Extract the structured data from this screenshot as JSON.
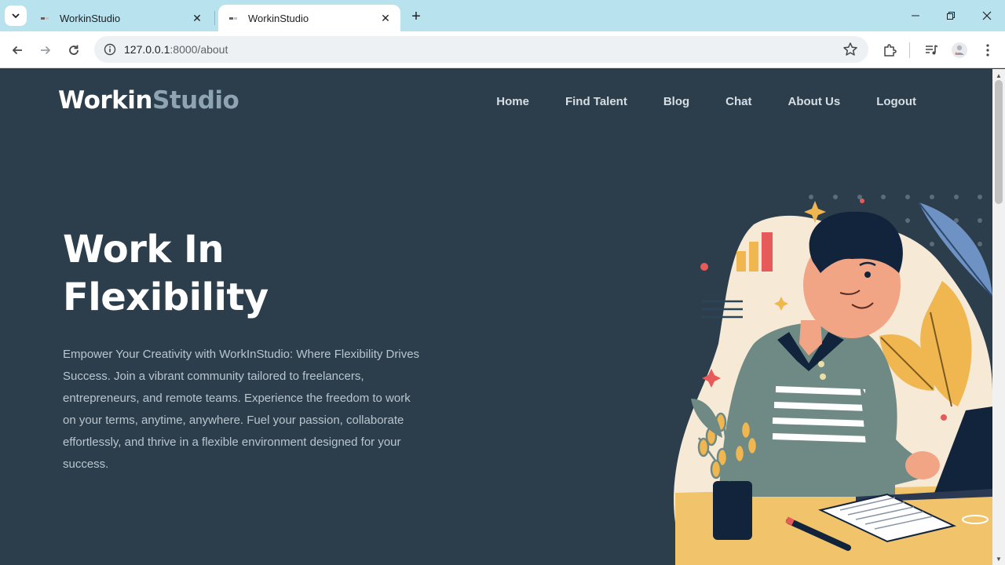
{
  "browser": {
    "tabs": [
      {
        "title": "WorkinStudio",
        "active": false
      },
      {
        "title": "WorkinStudio",
        "active": true
      }
    ],
    "address": {
      "host": "127.0.0.1",
      "rest": ":8000/about"
    }
  },
  "site": {
    "brand": {
      "part1": "Workin",
      "part2": "Studio"
    },
    "nav": [
      "Home",
      "Find Talent",
      "Blog",
      "Chat",
      "About Us",
      "Logout"
    ],
    "hero": {
      "title_line1": "Work In",
      "title_line2": "Flexibility",
      "description": "Empower Your Creativity with WorkInStudio: Where Flexibility Drives Success. Join a vibrant community tailored to freelancers, entrepreneurs, and remote teams. Experience the freedom to work on your terms, anytime, anywhere. Fuel your passion, collaborate effortlessly, and thrive in a flexible environment designed for your success."
    }
  },
  "colors": {
    "page_bg": "#2c3e4c",
    "brand_secondary": "#8ea4b3",
    "tabbar_bg": "#b8e3ee"
  },
  "icons": [
    "chevron-down-icon",
    "favicon-icon",
    "close-icon",
    "plus-icon",
    "minimize-icon",
    "restore-icon",
    "back-icon",
    "forward-icon",
    "reload-icon",
    "info-icon",
    "star-icon",
    "extensions-icon",
    "media-icon",
    "profile-avatar",
    "more-icon"
  ]
}
